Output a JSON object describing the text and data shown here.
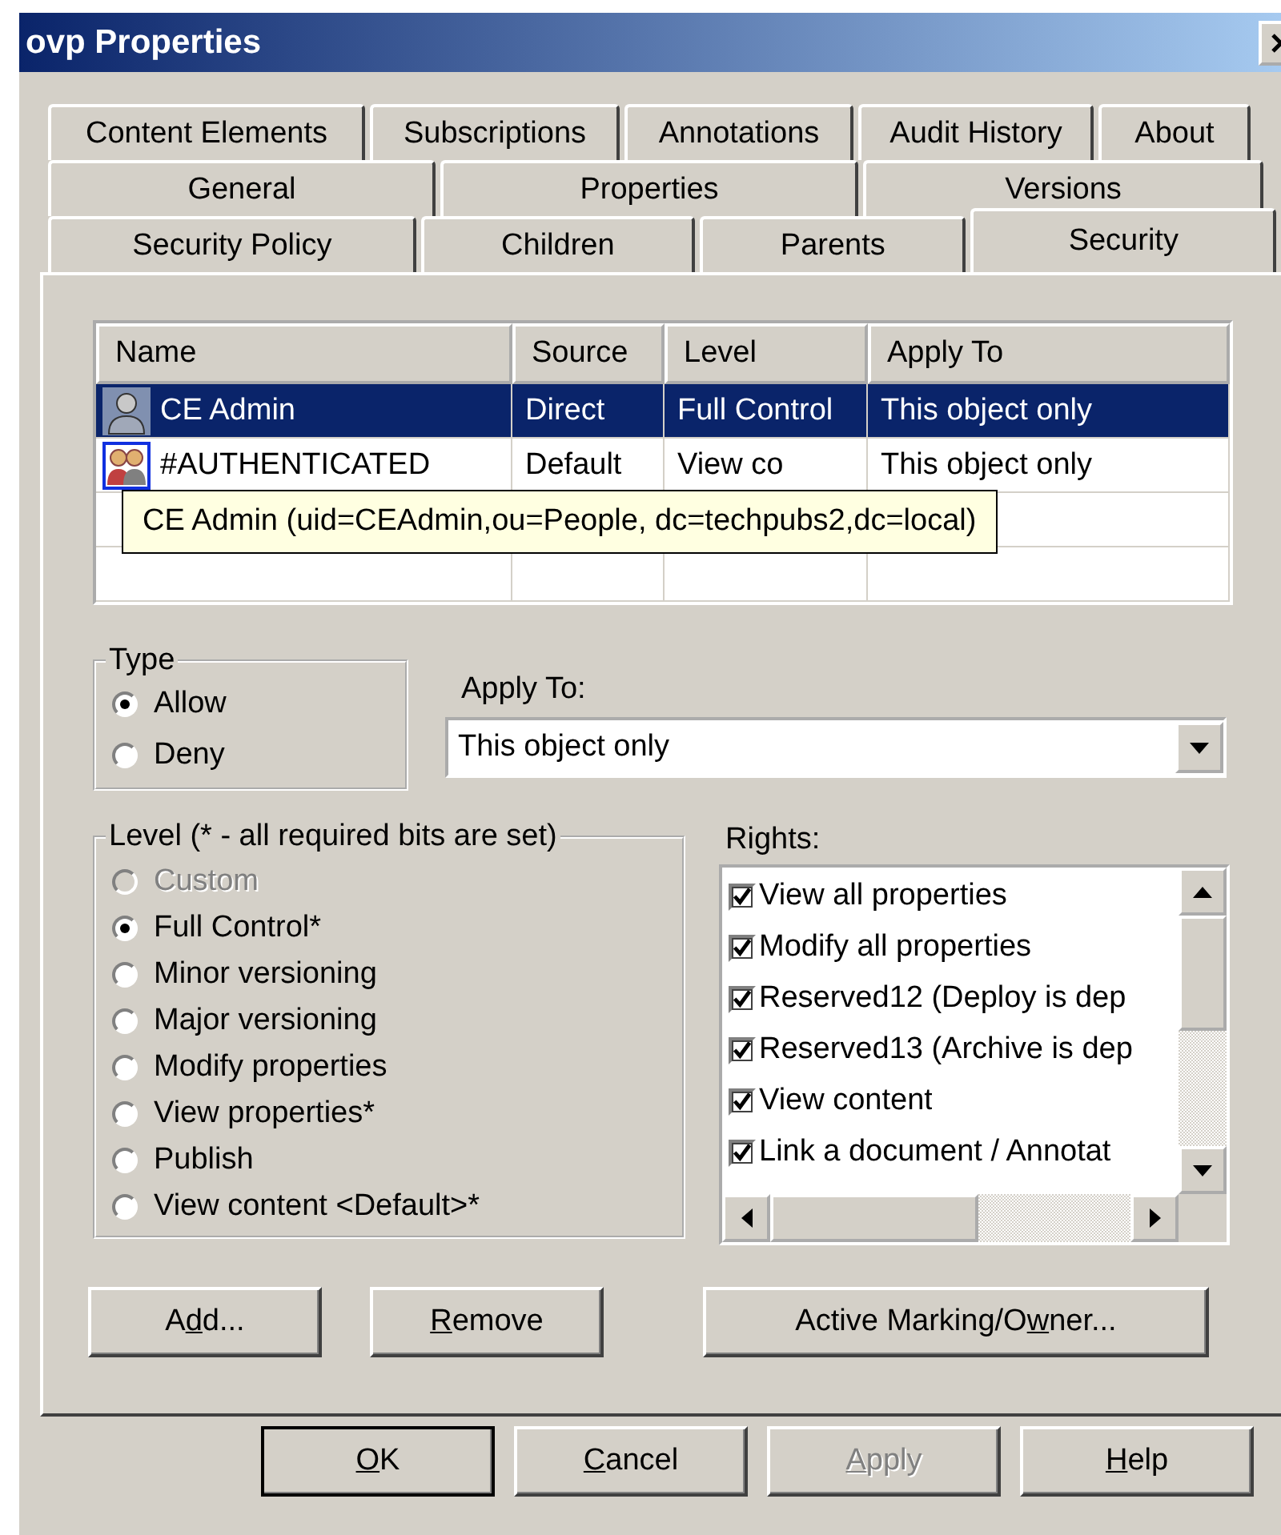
{
  "window": {
    "title": "ovp Properties"
  },
  "tab_rows": [
    [
      {
        "label": "Content Elements",
        "selected": false
      },
      {
        "label": "Subscriptions",
        "selected": false
      },
      {
        "label": "Annotations",
        "selected": false
      },
      {
        "label": "Audit History",
        "selected": false
      },
      {
        "label": "About",
        "selected": false
      }
    ],
    [
      {
        "label": "General",
        "selected": false
      },
      {
        "label": "Properties",
        "selected": false
      },
      {
        "label": "Versions",
        "selected": false
      }
    ],
    [
      {
        "label": "Security Policy",
        "selected": false
      },
      {
        "label": "Children",
        "selected": false
      },
      {
        "label": "Parents",
        "selected": false
      },
      {
        "label": "Security",
        "selected": true
      }
    ]
  ],
  "table": {
    "columns": [
      "Name",
      "Source",
      "Level",
      "Apply To"
    ],
    "rows": [
      {
        "kind": "user",
        "cells": [
          "CE Admin",
          "Direct",
          "Full Control",
          "This object only"
        ],
        "selected": true
      },
      {
        "kind": "group",
        "cells": [
          "#AUTHENTICATED",
          "Default",
          "View co",
          "This object only"
        ],
        "selected": false
      }
    ]
  },
  "tooltip": "CE Admin (uid=CEAdmin,ou=People, dc=techpubs2,dc=local)",
  "type_group": {
    "title": "Type",
    "options": [
      {
        "label": "Allow",
        "selected": true
      },
      {
        "label": "Deny",
        "selected": false
      }
    ]
  },
  "apply_to": {
    "label": "Apply To:",
    "value": "This object only"
  },
  "level_group": {
    "title": "Level (* - all required bits are set)",
    "options": [
      {
        "label": "Custom",
        "selected": false,
        "disabled": true
      },
      {
        "label": "Full Control*",
        "selected": true,
        "disabled": false
      },
      {
        "label": "Minor versioning",
        "selected": false,
        "disabled": false
      },
      {
        "label": "Major versioning",
        "selected": false,
        "disabled": false
      },
      {
        "label": "Modify properties",
        "selected": false,
        "disabled": false
      },
      {
        "label": "View properties*",
        "selected": false,
        "disabled": false
      },
      {
        "label": "Publish",
        "selected": false,
        "disabled": false
      },
      {
        "label": "View content <Default>*",
        "selected": false,
        "disabled": false
      }
    ]
  },
  "rights": {
    "label": "Rights:",
    "items": [
      {
        "label": "View all properties",
        "checked": true
      },
      {
        "label": "Modify all properties",
        "checked": true
      },
      {
        "label": "Reserved12 (Deploy is dep",
        "checked": true
      },
      {
        "label": "Reserved13 (Archive is dep",
        "checked": true
      },
      {
        "label": "View content",
        "checked": true
      },
      {
        "label": "Link a document / Annotat",
        "checked": true
      }
    ]
  },
  "panel_buttons": [
    {
      "before": "A",
      "key": "d",
      "after": "d..."
    },
    {
      "key": "R",
      "after": "emove"
    },
    {
      "before": "Active Marking/O",
      "key": "w",
      "after": "ner..."
    }
  ],
  "dialog_buttons": [
    {
      "key": "O",
      "after": "K",
      "default": true,
      "disabled": false
    },
    {
      "key": "C",
      "after": "ancel",
      "default": false,
      "disabled": false
    },
    {
      "key": "A",
      "after": "pply",
      "default": false,
      "disabled": true
    },
    {
      "key": "H",
      "after": "elp",
      "default": false,
      "disabled": false
    }
  ]
}
